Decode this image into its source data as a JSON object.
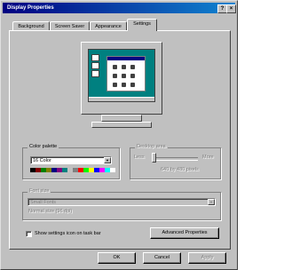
{
  "window": {
    "title": "Display Properties",
    "buttons": {
      "help": "?",
      "close": "×"
    }
  },
  "tabs": [
    {
      "label": "Background",
      "active": false
    },
    {
      "label": "Screen Saver",
      "active": false
    },
    {
      "label": "Appearance",
      "active": false
    },
    {
      "label": "Settings",
      "active": true
    }
  ],
  "color_palette": {
    "label": "Color palette",
    "value": "16 Color",
    "swatches": [
      "#000000",
      "#800000",
      "#008000",
      "#808000",
      "#000080",
      "#800080",
      "#008080",
      "#c0c0c0",
      "#808080",
      "#ff0000",
      "#00ff00",
      "#ffff00",
      "#0000ff",
      "#ff00ff",
      "#00ffff",
      "#ffffff"
    ]
  },
  "desktop_area": {
    "label": "Desktop area",
    "less": "Less",
    "more": "More",
    "resolution": "640 by 480 pixels",
    "slider_level": 0
  },
  "font_size": {
    "label": "Font size",
    "value": "Small Fonts",
    "note": "Normal size (96 dpi)"
  },
  "show_settings": {
    "label": "Show settings icon on task bar",
    "checked": false
  },
  "advanced_button": "Advanced Properties",
  "dialog_buttons": {
    "ok": "OK",
    "cancel": "Cancel",
    "apply": "Apply"
  }
}
